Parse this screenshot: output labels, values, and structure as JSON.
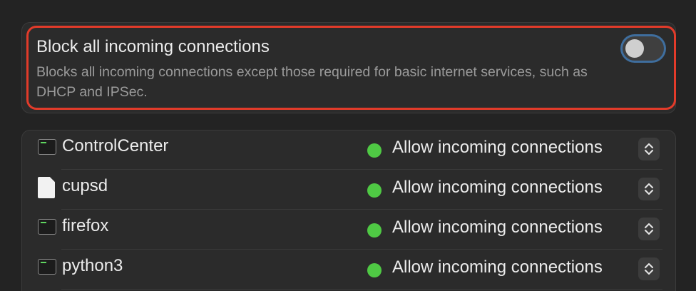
{
  "block_setting": {
    "title": "Block all incoming connections",
    "description": "Blocks all incoming connections except those required for basic internet services, such as DHCP and IPSec.",
    "toggle_on": false
  },
  "apps": [
    {
      "name": "ControlCenter",
      "icon": "terminal-icon",
      "status": "Allow incoming connections",
      "status_color": "#4fc944"
    },
    {
      "name": "cupsd",
      "icon": "document-icon",
      "status": "Allow incoming connections",
      "status_color": "#4fc944"
    },
    {
      "name": "firefox",
      "icon": "terminal-icon",
      "status": "Allow incoming connections",
      "status_color": "#4fc944"
    },
    {
      "name": "python3",
      "icon": "terminal-icon",
      "status": "Allow incoming connections",
      "status_color": "#4fc944"
    }
  ],
  "colors": {
    "highlight": "#e23b2a",
    "toggle_focus_ring": "#3f6e9e",
    "allow": "#4fc944"
  }
}
